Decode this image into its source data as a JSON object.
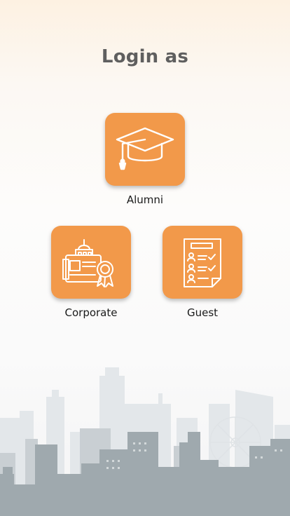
{
  "header": {
    "title": "Login as"
  },
  "options": [
    {
      "label": "Alumni",
      "icon": "graduation-cap-icon"
    },
    {
      "label": "Corporate",
      "icon": "corporate-building-icon"
    },
    {
      "label": "Guest",
      "icon": "guest-list-icon"
    }
  ],
  "colors": {
    "accent": "#f2994a",
    "title_text": "#5f5f5f",
    "label_text": "#1a1a1a",
    "skyline_dark": "#9aa5aa",
    "skyline_light": "#dde2e6"
  }
}
